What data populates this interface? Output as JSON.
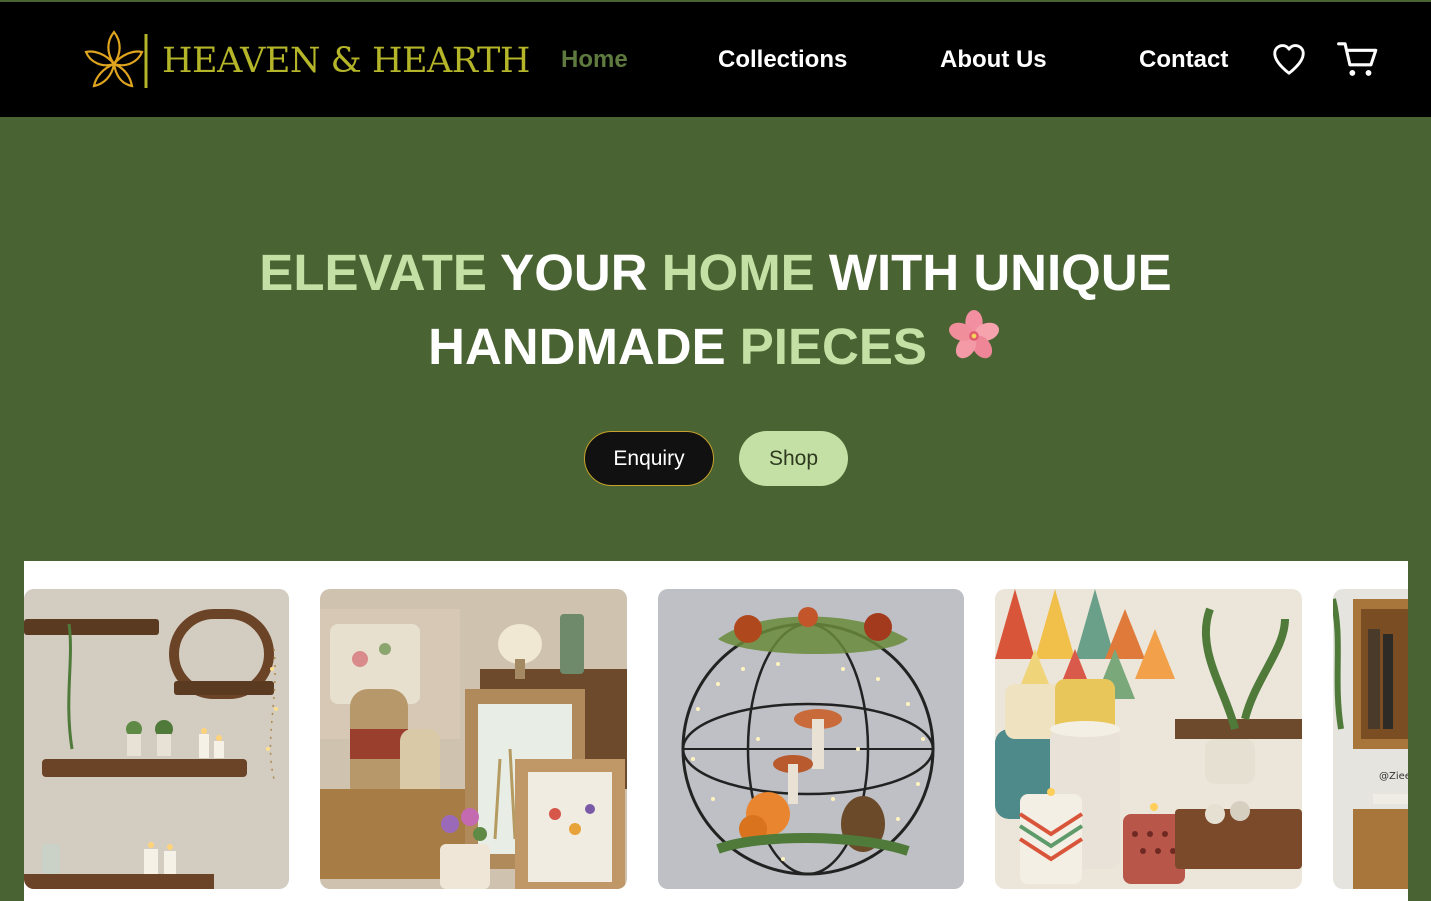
{
  "brand": {
    "name": "HEAVEN & HEARTH",
    "color": "#b5b52a"
  },
  "nav": {
    "links": [
      {
        "label": "Home",
        "active": true
      },
      {
        "label": "Collections",
        "active": false
      },
      {
        "label": "About Us",
        "active": false
      },
      {
        "label": "Contact",
        "active": false
      }
    ],
    "icons": [
      "heart-icon",
      "cart-icon"
    ]
  },
  "hero": {
    "title_parts": [
      "ELEVATE",
      " YOUR ",
      "HOME",
      " WITH UNIQUE",
      "HANDMADE ",
      "PIECES"
    ],
    "buttons": {
      "enquiry": "Enquiry",
      "shop": "Shop"
    }
  },
  "gallery": {
    "cards": [
      {
        "label": "wall-shelves-candles"
      },
      {
        "label": "baskets-frames-vases"
      },
      {
        "label": "hanging-sphere-lights"
      },
      {
        "label": "patterned-candle-holders"
      },
      {
        "label": "wooden-crate-shelves"
      }
    ],
    "partial_text": "@Ziee"
  },
  "colors": {
    "nav_bg": "#000000",
    "hero_bg": "#4a6332",
    "accent_green": "#c5e0a5",
    "active_link": "#5e7a3f",
    "brand_gold": "#b5b52a"
  }
}
